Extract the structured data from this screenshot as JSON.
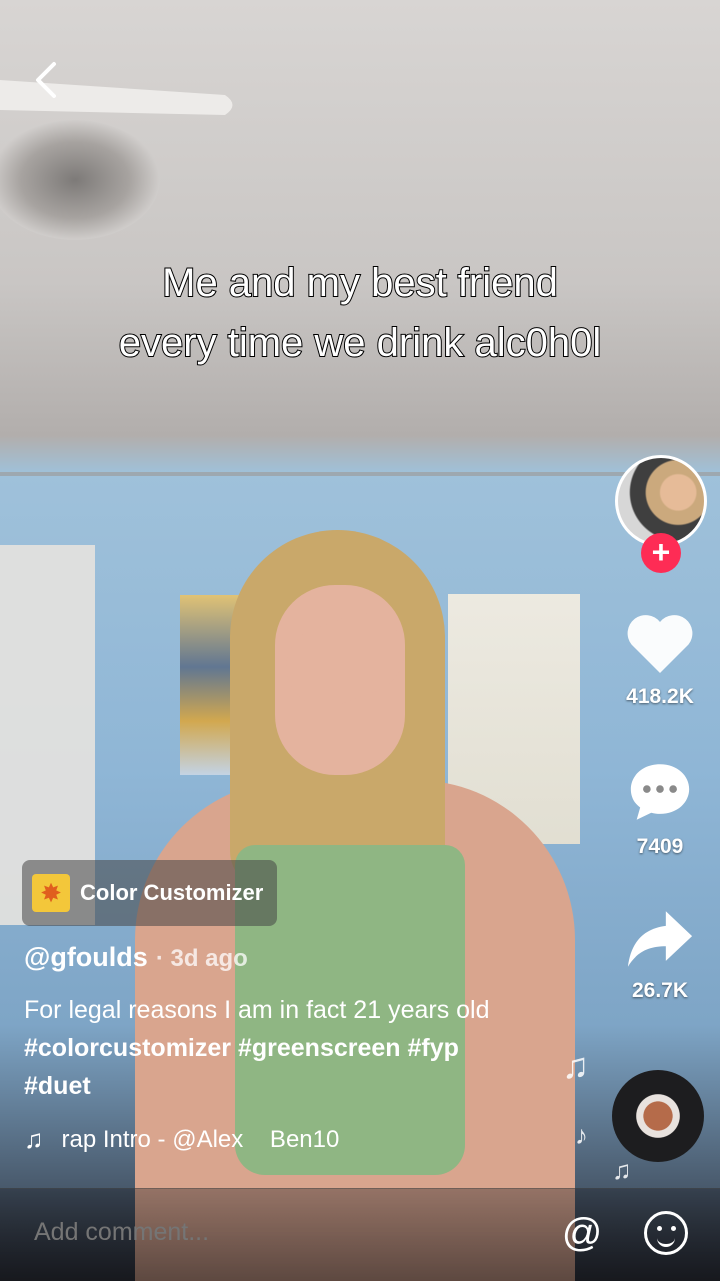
{
  "video": {
    "caption_lines": [
      "Me and my best friend",
      "every time we drink alc0h0l"
    ]
  },
  "author": {
    "username": "@gfoulds",
    "time_ago": "· 3d ago"
  },
  "effect": {
    "label": "Color Customizer"
  },
  "description": {
    "text": "For legal reasons I am in fact 21 years old",
    "hashtags": [
      "#colorcustomizer",
      "#greenscreen",
      "#fyp",
      "#duet"
    ]
  },
  "music": {
    "title": "rap Intro - @Alex    Ben10"
  },
  "actions": {
    "likes": "418.2K",
    "comments": "7409",
    "shares": "26.7K"
  },
  "comment_bar": {
    "placeholder": "Add comment..."
  },
  "colors": {
    "follow_accent": "#fe2c55",
    "effect_icon": "#f3c73a"
  },
  "icons": [
    "back-icon",
    "heart-icon",
    "comment-icon",
    "share-icon",
    "plus-icon",
    "music-note-icon",
    "at-icon",
    "emoji-icon",
    "sparkle-icon"
  ]
}
